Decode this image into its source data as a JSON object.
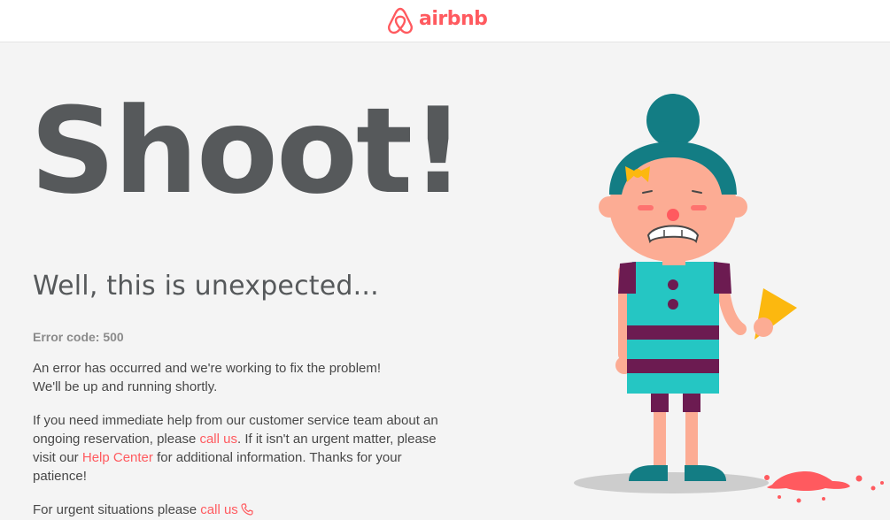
{
  "header": {
    "brand_name": "airbnb",
    "logo_icon": "airbnb-belo-icon",
    "brand_color": "#ff5a5f"
  },
  "error_page": {
    "title": "Shoot!",
    "subtitle": "Well, this is unexpected...",
    "error_code": "Error code: 500",
    "paragraph1": {
      "line1": "An error has occurred and we're working to fix the problem!",
      "line2": "We'll be up and running shortly."
    },
    "paragraph2": {
      "text_before_link": "If you need immediate help from our customer service team about an ongoing reservation, please ",
      "call_link": "call us",
      "text_middle": ". If it isn't an urgent matter, please visit our ",
      "help_link": "Help Center",
      "text_after": " for additional information. Thanks for your patience!"
    },
    "paragraph3": {
      "text": "For urgent situations please ",
      "call_link": "call us",
      "phone_icon": "phone-icon"
    }
  },
  "illustration": {
    "description_icon": "crying-girl-dropped-ice-cream-icon",
    "colors": {
      "hair": "#137d84",
      "skin": "#fcac94",
      "dress": "#25c6c3",
      "stripes": "#6c1b51",
      "cone": "#fcb80f",
      "ice_cream": "#ff5a5f",
      "shadow": "#cdcdcd"
    }
  }
}
